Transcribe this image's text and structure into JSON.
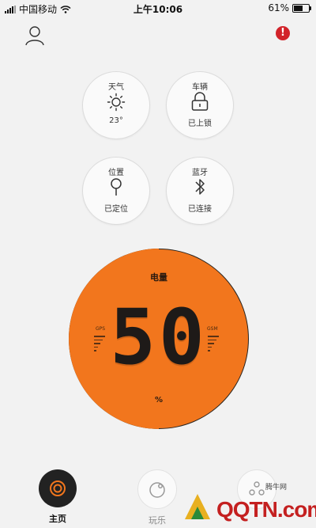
{
  "status_bar": {
    "carrier": "中国移动",
    "time": "上午10:06",
    "battery_percent": "61%",
    "battery_level": 0.61,
    "wifi_icon": "wifi-icon"
  },
  "header": {
    "profile_icon": "user-icon",
    "alert_symbol": "!",
    "alert_color": "#d2232a"
  },
  "tiles": [
    {
      "label": "天气",
      "status": "23°",
      "icon": "sun-icon"
    },
    {
      "label": "车辆",
      "status": "已上锁",
      "icon": "lock-icon"
    },
    {
      "label": "位置",
      "status": "已定位",
      "icon": "location-pin-icon"
    },
    {
      "label": "蓝牙",
      "status": "已连接",
      "icon": "bluetooth-icon"
    }
  ],
  "gauge": {
    "title": "电量",
    "value": "50",
    "unit": "%",
    "level_percent": 50,
    "gps_label": "GPS",
    "gsm_label": "GSM",
    "face_color": "#f2761d"
  },
  "tab_bar": {
    "tabs": [
      {
        "label": "主页",
        "icon": "home-ring-icon",
        "active": true
      },
      {
        "label": "玩乐",
        "icon": "play-icon",
        "active": false
      },
      {
        "label": "",
        "icon": "dots-icon",
        "active": false
      }
    ]
  },
  "watermark": {
    "text": "QQTN.com",
    "small_text": "腾牛网"
  }
}
